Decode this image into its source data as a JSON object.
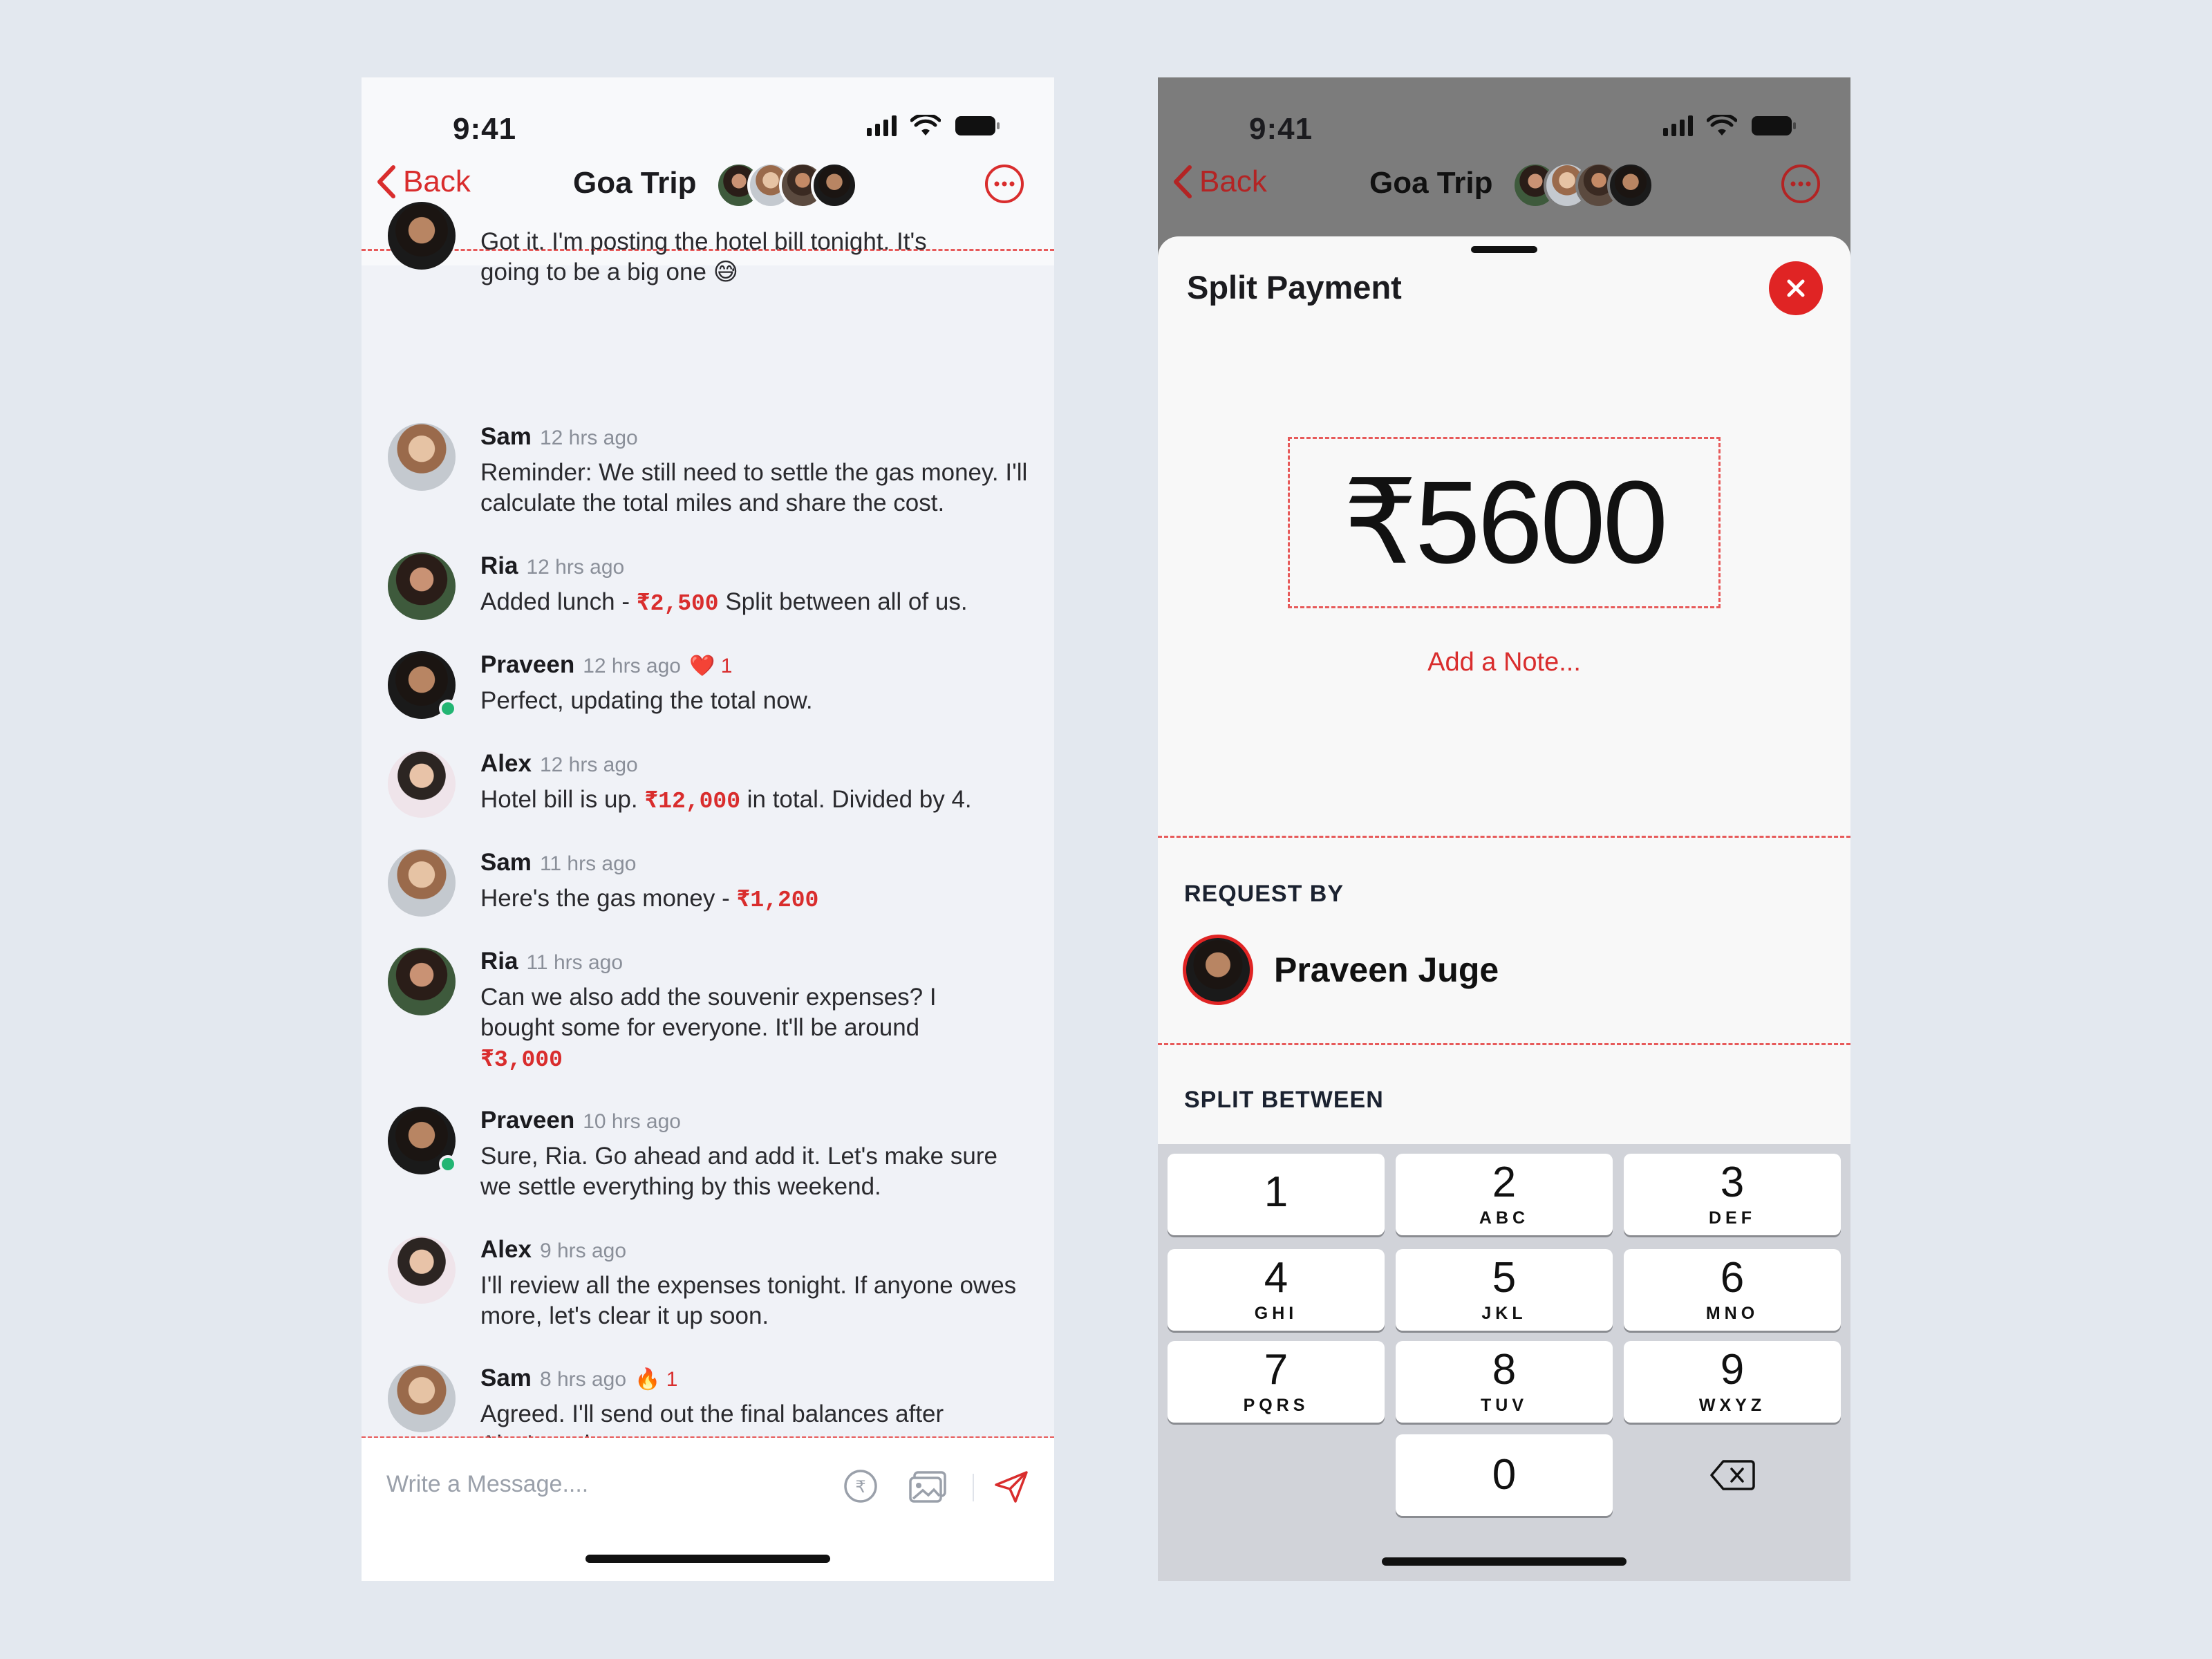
{
  "status": {
    "time": "9:41"
  },
  "chat_screen": {
    "header": {
      "back_label": "Back",
      "title": "Goa Trip"
    },
    "first_message_partial": "Got it. I'm posting the hotel bill tonight. It's going to be a big one 😅",
    "messages": [
      {
        "name": "Sam",
        "time": "12 hrs ago",
        "reaction": "",
        "parts": [
          "Reminder: We still need to settle the gas money. I'll calculate the total miles and share the cost."
        ],
        "amount": "",
        "suffix": ""
      },
      {
        "name": "Ria",
        "time": "12 hrs ago",
        "reaction": "",
        "parts": [
          "Added lunch - "
        ],
        "amount": "₹2,500",
        "suffix": " Split between all of us."
      },
      {
        "name": "Praveen",
        "time": "12 hrs ago",
        "reaction": "❤️ 1",
        "parts": [
          "Perfect, updating the total now."
        ],
        "amount": "",
        "suffix": ""
      },
      {
        "name": "Alex",
        "time": "12 hrs ago",
        "reaction": "",
        "parts": [
          "Hotel bill is up. "
        ],
        "amount": "₹12,000",
        "suffix": " in total. Divided by 4."
      },
      {
        "name": "Sam",
        "time": "11 hrs ago",
        "reaction": "",
        "parts": [
          "Here's the gas money - "
        ],
        "amount": "₹1,200",
        "suffix": ""
      },
      {
        "name": "Ria",
        "time": "11 hrs ago",
        "reaction": "",
        "parts": [
          "Can we also add the souvenir expenses? I bought some for everyone. It'll be around "
        ],
        "amount": "₹3,000",
        "suffix": ""
      },
      {
        "name": "Praveen",
        "time": "10 hrs ago",
        "reaction": "",
        "parts": [
          "Sure, Ria. Go ahead and add it. Let's make sure we settle everything by this weekend."
        ],
        "amount": "",
        "suffix": ""
      },
      {
        "name": "Alex",
        "time": "9 hrs ago",
        "reaction": "",
        "parts": [
          "I'll review all the expenses tonight. If anyone owes more, let's clear it up soon."
        ],
        "amount": "",
        "suffix": ""
      },
      {
        "name": "Sam",
        "time": "8 hrs ago",
        "reaction": "🔥 1",
        "parts": [
          "Agreed. I'll send out the final balances after Alex's review."
        ],
        "amount": "",
        "suffix": ""
      }
    ],
    "composer": {
      "placeholder": "Write a Message...."
    }
  },
  "split_sheet": {
    "title": "Split Payment",
    "amount": "₹5600",
    "add_note": "Add a Note...",
    "request_by_label": "REQUEST BY",
    "requester_name": "Praveen Juge",
    "split_between_label": "SPLIT BETWEEN",
    "keypad": [
      {
        "digit": "1",
        "letters": ""
      },
      {
        "digit": "2",
        "letters": "ABC"
      },
      {
        "digit": "3",
        "letters": "DEF"
      },
      {
        "digit": "4",
        "letters": "GHI"
      },
      {
        "digit": "5",
        "letters": "JKL"
      },
      {
        "digit": "6",
        "letters": "MNO"
      },
      {
        "digit": "7",
        "letters": "PQRS"
      },
      {
        "digit": "8",
        "letters": "TUV"
      },
      {
        "digit": "9",
        "letters": "WXYZ"
      },
      {
        "digit": "0",
        "letters": ""
      }
    ]
  },
  "icons": {
    "back": "chevron-left-icon",
    "more": "more-horizontal-icon",
    "rupee": "rupee-icon",
    "gallery": "gallery-icon",
    "send": "send-icon",
    "close": "close-icon",
    "backspace": "backspace-icon"
  },
  "colors": {
    "accent": "#d92d2d",
    "online": "#22b573",
    "background": "#e3e8ef"
  }
}
